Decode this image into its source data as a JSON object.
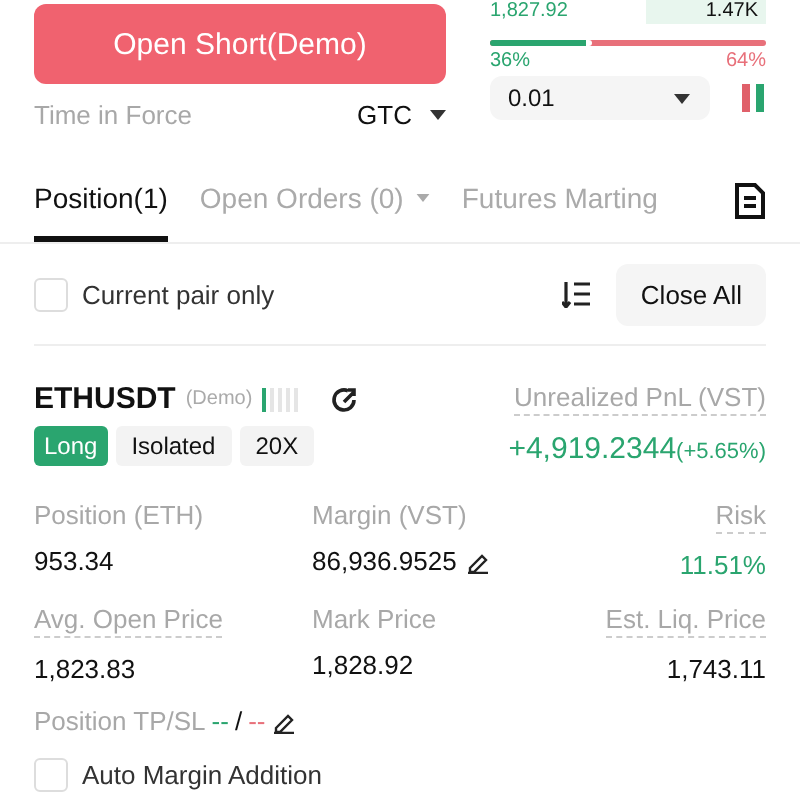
{
  "order": {
    "button": "Open Short(Demo)",
    "time_in_force_label": "Time in Force",
    "time_in_force_value": "GTC"
  },
  "book": {
    "price": "1,827.92",
    "size": "1.47K",
    "buy_share": {
      "label": "36%",
      "level": 0.37
    },
    "sell_share": {
      "label": "64%"
    },
    "precision": "0.01"
  },
  "tabs": [
    {
      "label": "Position(1)",
      "selected": true,
      "dropdown": false
    },
    {
      "label": "Open Orders (0)",
      "selected": false,
      "dropdown": true
    },
    {
      "label": "Futures Marting",
      "selected": false,
      "dropdown": false
    }
  ],
  "filter": {
    "label": "Current pair only",
    "checked": false
  },
  "close_all": "Close All",
  "position": {
    "symbol": "ETHUSDT",
    "mode": "(Demo)",
    "adl": {
      "level": 0.2
    },
    "tags": [
      {
        "label": "Long",
        "kind": "side"
      },
      {
        "label": "Isolated",
        "kind": "plain"
      },
      {
        "label": "20X",
        "kind": "plain"
      }
    ],
    "pnl_label": "Unrealized PnL (VST)",
    "pnl_value": "+4,919.2344",
    "pnl_percent": "(+5.65%)",
    "fields": [
      {
        "label": "Position (ETH)",
        "value": "953.34",
        "dotted": false,
        "editable": false,
        "positive": false
      },
      {
        "label": "Margin (VST)",
        "value": "86,936.9525",
        "dotted": false,
        "editable": true,
        "positive": false
      },
      {
        "label": "Risk",
        "value": "11.51%",
        "dotted": true,
        "editable": false,
        "positive": true
      },
      {
        "label": "Avg. Open Price",
        "value": "1,823.83",
        "dotted": true,
        "editable": false,
        "positive": false
      },
      {
        "label": "Mark Price",
        "value": "1,828.92",
        "dotted": false,
        "editable": false,
        "positive": false
      },
      {
        "label": "Est. Liq. Price",
        "value": "1,743.11",
        "dotted": true,
        "editable": false,
        "positive": false
      }
    ],
    "tpsl_label": "Position TP/SL",
    "tp": "--",
    "separator": "/",
    "sl": "--",
    "auto_margin": {
      "label": "Auto Margin Addition",
      "checked": false
    }
  }
}
